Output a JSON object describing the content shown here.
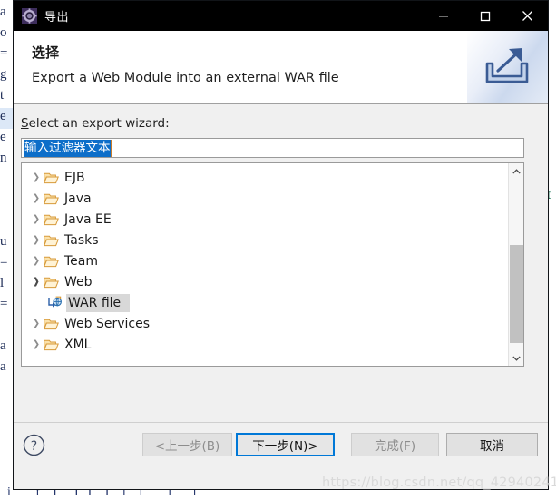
{
  "window": {
    "title": "导出",
    "icon": "export-wizard-icon",
    "controls": {
      "minimize": "—",
      "maximize": "☐",
      "close": "✕"
    }
  },
  "header": {
    "title": "选择",
    "description": "Export a Web Module into an external WAR file",
    "banner_icon": "export-banner-icon"
  },
  "main": {
    "select_label_accesskey": "S",
    "select_label_rest": "elect an export wizard:",
    "filter": {
      "value": "输入过滤器文本",
      "placeholder": "输入过滤器文本",
      "selected": true
    },
    "tree": [
      {
        "label": "EJB",
        "level": 0,
        "expanded": false,
        "icon": "folder-icon",
        "selected": false
      },
      {
        "label": "Java",
        "level": 0,
        "expanded": false,
        "icon": "folder-icon",
        "selected": false
      },
      {
        "label": "Java EE",
        "level": 0,
        "expanded": false,
        "icon": "folder-icon",
        "selected": false
      },
      {
        "label": "Tasks",
        "level": 0,
        "expanded": false,
        "icon": "folder-icon",
        "selected": false
      },
      {
        "label": "Team",
        "level": 0,
        "expanded": false,
        "icon": "folder-icon",
        "selected": false
      },
      {
        "label": "Web",
        "level": 0,
        "expanded": true,
        "icon": "folder-icon",
        "selected": false
      },
      {
        "label": "WAR file",
        "level": 1,
        "expanded": null,
        "icon": "war-file-icon",
        "selected": true
      },
      {
        "label": "Web Services",
        "level": 0,
        "expanded": false,
        "icon": "folder-icon",
        "selected": false
      },
      {
        "label": "XML",
        "level": 0,
        "expanded": false,
        "icon": "folder-icon",
        "selected": false
      }
    ],
    "scrollbar": {
      "up_arrow": "⌃",
      "down_arrow": "⌄"
    },
    "annotation": {
      "color": "#ff0f1a",
      "targets": "Web / WAR file"
    }
  },
  "footer": {
    "help_icon": "help-question-icon",
    "buttons": [
      {
        "id": "back",
        "label": "<上一步(B)",
        "state": "disabled"
      },
      {
        "id": "next",
        "label": "下一步(N)>",
        "state": "focused"
      },
      {
        "id": "finish",
        "label": "完成(F)",
        "state": "disabled"
      },
      {
        "id": "cancel",
        "label": "取消",
        "state": "enabled"
      }
    ]
  },
  "watermark": "https://blog.csdn.net/qq_42940241",
  "background": {
    "left_column": "a\no\n=\ng\nt\ne\ne\nn\n\n\n\nu\n=\nl\n=\n\na\na\n",
    "right_char": "t",
    "bottom_text": "i      t   I    I  I   I   i   ì      i     i"
  }
}
